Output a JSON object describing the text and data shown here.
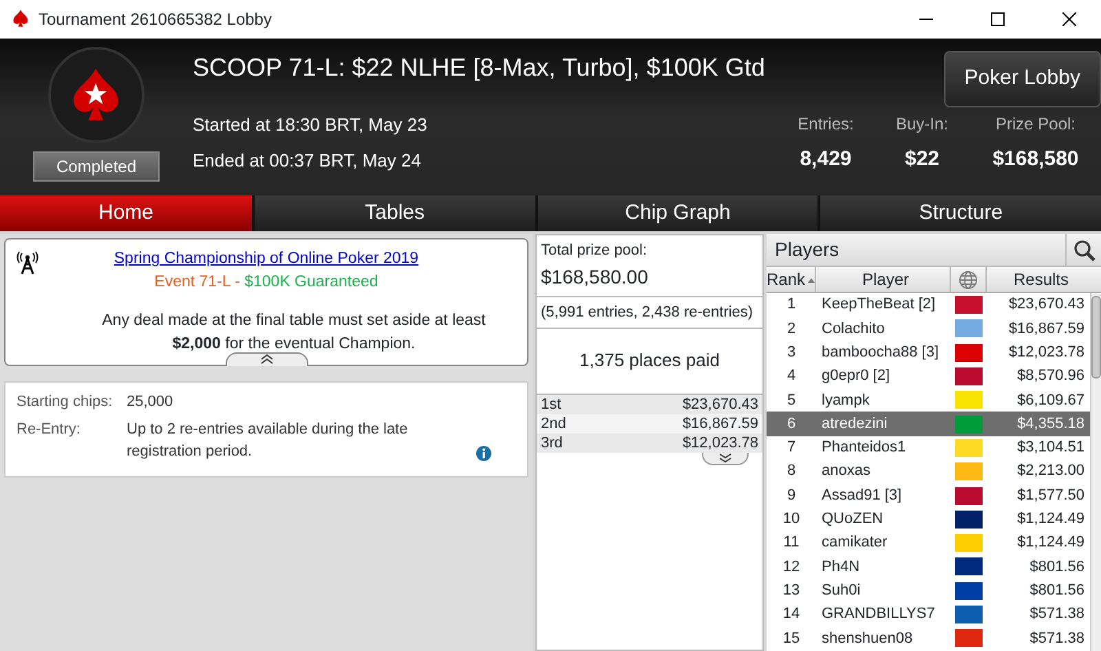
{
  "window": {
    "title": "Tournament 2610665382 Lobby"
  },
  "header": {
    "title": "SCOOP 71-L: $22 NLHE [8-Max, Turbo], $100K Gtd",
    "status": "Completed",
    "started": "Started at 18:30 BRT, May 23",
    "ended": "Ended at 00:37 BRT, May 24",
    "lobby_button": "Poker Lobby",
    "stats": [
      {
        "label": "Entries:",
        "value": "8,429"
      },
      {
        "label": "Buy-In:",
        "value": "$22"
      },
      {
        "label": "Prize Pool:",
        "value": "$168,580"
      }
    ]
  },
  "tabs": [
    {
      "label": "Home",
      "selected": true
    },
    {
      "label": "Tables",
      "selected": false
    },
    {
      "label": "Chip Graph",
      "selected": false
    },
    {
      "label": "Structure",
      "selected": false
    }
  ],
  "info": {
    "link": "Spring Championship of Online Poker 2019",
    "event": "Event 71-L",
    "separator": " - ",
    "guarantee": "$100K Guaranteed",
    "note": "Any deal made at the final table must set aside at least **$2,000** for the eventual Champion."
  },
  "details": [
    {
      "label": "Starting chips:",
      "value": "25,000",
      "info": false
    },
    {
      "label": "Re-Entry:",
      "value": "Up to 2 re-entries available during the late registration period.",
      "info": true
    }
  ],
  "prize": {
    "label": "Total prize pool:",
    "total": "$168,580.00",
    "entries": "(5,991 entries, 2,438 re-entries)",
    "paid": "1,375 places paid",
    "places": [
      {
        "place": "1st",
        "amount": "$23,670.43"
      },
      {
        "place": "2nd",
        "amount": "$16,867.59"
      },
      {
        "place": "3rd",
        "amount": "$12,023.78"
      }
    ]
  },
  "players": {
    "title": "Players",
    "columns": [
      "Rank",
      "Player",
      "Results"
    ],
    "rows": [
      {
        "rank": "1",
        "player": "KeepTheBeat [2]",
        "result": "$23,670.43",
        "selected": false,
        "color": "#c8102e"
      },
      {
        "rank": "2",
        "player": "Colachito",
        "result": "$16,867.59",
        "selected": false,
        "color": "#74acdf"
      },
      {
        "rank": "3",
        "player": "bamboocha88 [3]",
        "result": "$12,023.78",
        "selected": false,
        "color": "#dd0000"
      },
      {
        "rank": "4",
        "player": "g0epr0 [2]",
        "result": "$8,570.96",
        "selected": false,
        "color": "#ba0c2f"
      },
      {
        "rank": "5",
        "player": "lyampk",
        "result": "$6,109.67",
        "selected": false,
        "color": "#f9e300"
      },
      {
        "rank": "6",
        "player": "atredezini",
        "result": "$4,355.18",
        "selected": true,
        "color": "#009c3b"
      },
      {
        "rank": "7",
        "player": "Phanteidos1",
        "result": "$3,104.51",
        "selected": false,
        "color": "#fdda24"
      },
      {
        "rank": "8",
        "player": "anoxas",
        "result": "$2,213.00",
        "selected": false,
        "color": "#fdb913"
      },
      {
        "rank": "9",
        "player": "Assad91 [3]",
        "result": "$1,577.50",
        "selected": false,
        "color": "#ba0c2f"
      },
      {
        "rank": "10",
        "player": "QUoZEN",
        "result": "$1,124.49",
        "selected": false,
        "color": "#012169"
      },
      {
        "rank": "11",
        "player": "camikater",
        "result": "$1,124.49",
        "selected": false,
        "color": "#ffce00"
      },
      {
        "rank": "12",
        "player": "Ph4N",
        "result": "$801.56",
        "selected": false,
        "color": "#002b7f"
      },
      {
        "rank": "13",
        "player": "Suh0i",
        "result": "$801.56",
        "selected": false,
        "color": "#003da5"
      },
      {
        "rank": "14",
        "player": "GRANDBILLYS7",
        "result": "$571.38",
        "selected": false,
        "color": "#0d5eaf"
      },
      {
        "rank": "15",
        "player": "shenshuen08",
        "result": "$571.38",
        "selected": false,
        "color": "#de2910"
      }
    ]
  }
}
